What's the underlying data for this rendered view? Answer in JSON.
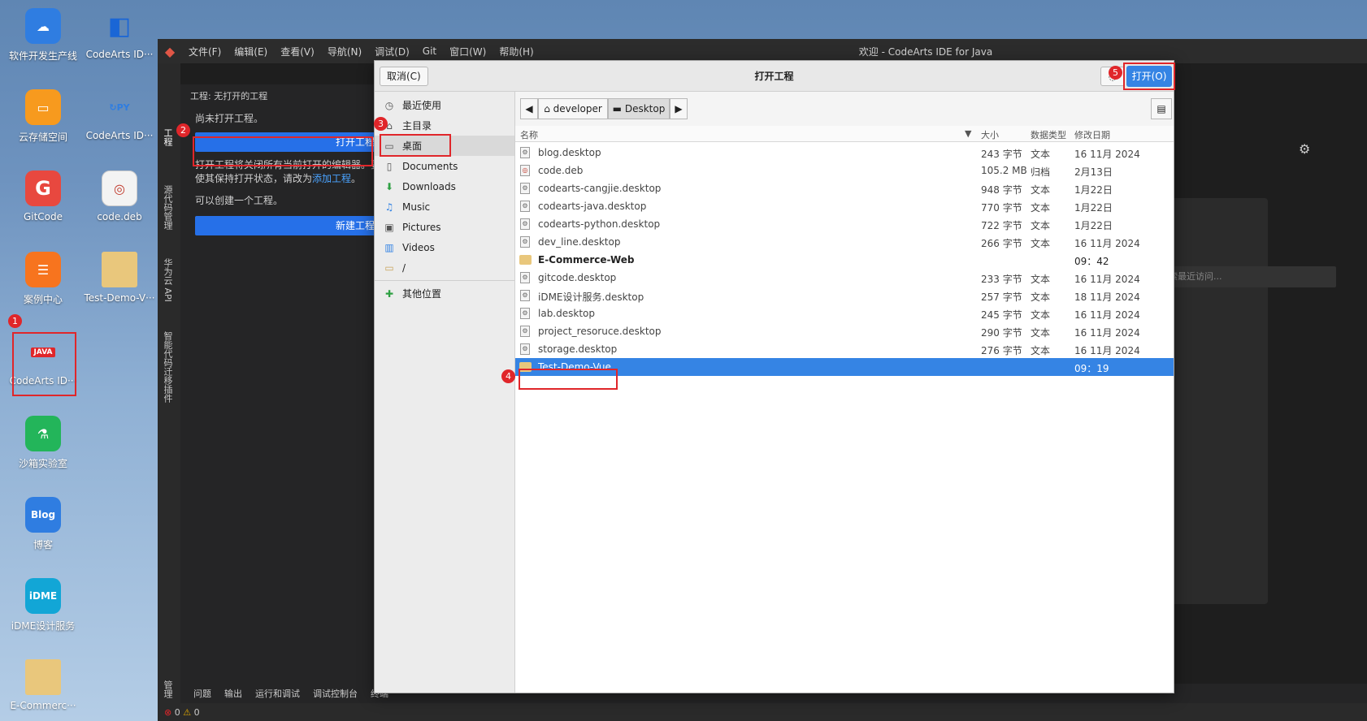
{
  "desktop": {
    "icons": [
      {
        "label": "软件开发生产线"
      },
      {
        "label": "CodeArts ID···"
      },
      {
        "label": "云存储空间"
      },
      {
        "label": "CodeArts ID···"
      },
      {
        "label": "GitCode"
      },
      {
        "label": "code.deb"
      },
      {
        "label": "案例中心"
      },
      {
        "label": "Test-Demo-V···"
      },
      {
        "label": "CodeArts ID···",
        "badge_text": "JAVA"
      },
      {
        "label": "沙箱实验室"
      },
      {
        "label": "博客",
        "badge_text": "Blog"
      },
      {
        "label": "iDME设计服务",
        "badge_text": "iDME"
      },
      {
        "label": "E-Commerc···"
      }
    ]
  },
  "ide": {
    "window_title": "欢迎 - CodeArts IDE for Java",
    "menus": [
      "文件(F)",
      "编辑(E)",
      "查看(V)",
      "导航(N)",
      "调试(D)",
      "Git",
      "窗口(W)",
      "帮助(H)"
    ],
    "activity_tabs": [
      "工程",
      "源代码管理",
      "华为云 API",
      "智能代码迁移插件",
      "管理"
    ],
    "sidebar": {
      "header": "工程: 无打开的工程",
      "no_project": "尚未打开工程。",
      "open_button": "打开工程",
      "info_line1": "打开工程将关闭所有当前打开的编辑器。要",
      "info_line2": "使其保持打开状态，请改为",
      "info_link": "添加工程",
      "info_end": "。",
      "create_text": "可以创建一个工程。",
      "new_button": "新建工程"
    },
    "welcome_search_placeholder": "索最近访问...",
    "bottom_tabs": [
      "问题",
      "输出",
      "运行和调试",
      "调试控制台",
      "终端"
    ],
    "status": {
      "errors": "0",
      "warnings": "0"
    }
  },
  "dialog": {
    "cancel": "取消(C)",
    "title": "打开工程",
    "open": "打开(O)",
    "places": [
      "最近使用",
      "主目录",
      "桌面",
      "Documents",
      "Downloads",
      "Music",
      "Pictures",
      "Videos",
      "/",
      "其他位置"
    ],
    "path": [
      "developer",
      "Desktop"
    ],
    "columns": {
      "name": "名称",
      "size": "大小",
      "type": "数据类型",
      "modified": "修改日期"
    },
    "files": [
      {
        "name": "blog.desktop",
        "size": "243 字节",
        "type": "文本",
        "modified": "16 11月 2024"
      },
      {
        "name": "code.deb",
        "size": "105.2 MB",
        "type": "归档",
        "modified": "2月13日"
      },
      {
        "name": "codearts-cangjie.desktop",
        "size": "948 字节",
        "type": "文本",
        "modified": "1月22日"
      },
      {
        "name": "codearts-java.desktop",
        "size": "770 字节",
        "type": "文本",
        "modified": "1月22日"
      },
      {
        "name": "codearts-python.desktop",
        "size": "722 字节",
        "type": "文本",
        "modified": "1月22日"
      },
      {
        "name": "dev_line.desktop",
        "size": "266 字节",
        "type": "文本",
        "modified": "16 11月 2024"
      },
      {
        "name": "E-Commerce-Web",
        "size": "",
        "type": "",
        "modified": "09：42"
      },
      {
        "name": "gitcode.desktop",
        "size": "233 字节",
        "type": "文本",
        "modified": "16 11月 2024"
      },
      {
        "name": "iDME设计服务.desktop",
        "size": "257 字节",
        "type": "文本",
        "modified": "18 11月 2024"
      },
      {
        "name": "lab.desktop",
        "size": "245 字节",
        "type": "文本",
        "modified": "16 11月 2024"
      },
      {
        "name": "project_resoruce.desktop",
        "size": "290 字节",
        "type": "文本",
        "modified": "16 11月 2024"
      },
      {
        "name": "storage.desktop",
        "size": "276 字节",
        "type": "文本",
        "modified": "16 11月 2024"
      },
      {
        "name": "Test-Demo-Vue",
        "size": "",
        "type": "",
        "modified": "09：19"
      }
    ]
  },
  "steps": [
    "1",
    "2",
    "3",
    "4",
    "5"
  ],
  "colors": {
    "accent": "#3584e4",
    "ide_button": "#2670e8",
    "highlight": "#e0262a"
  }
}
